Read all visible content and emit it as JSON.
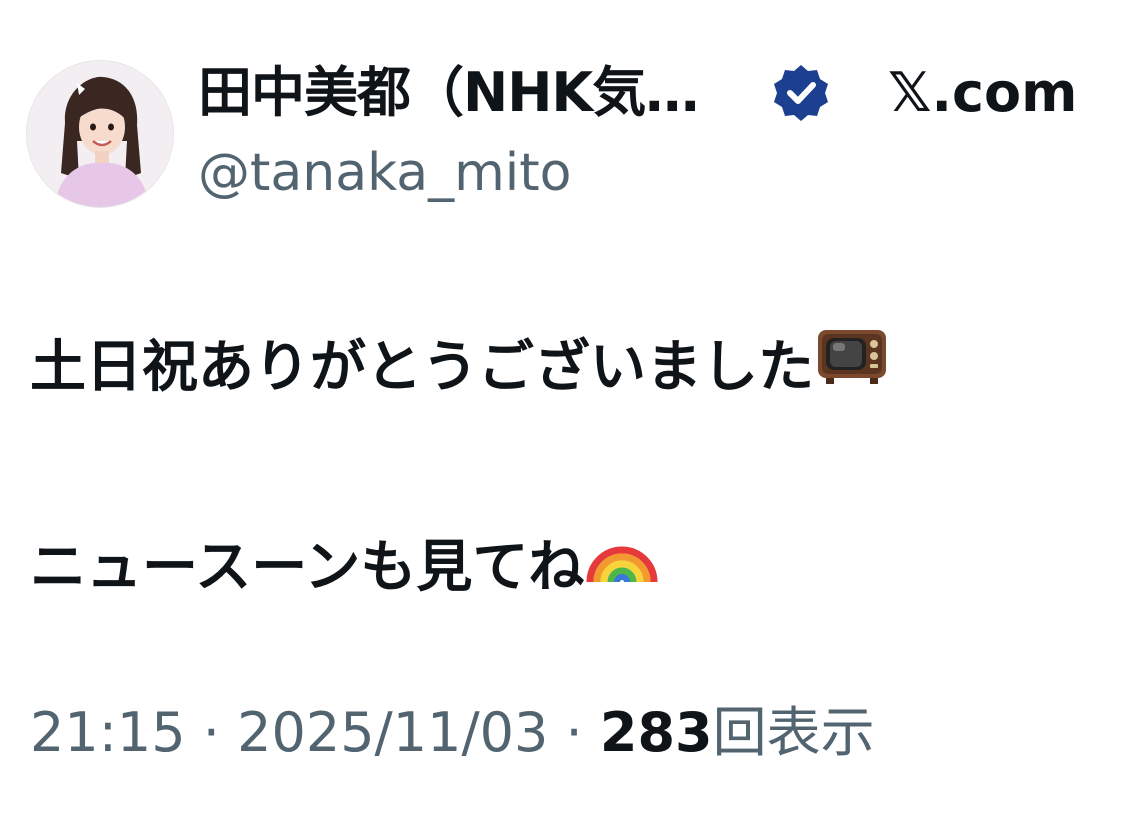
{
  "author": {
    "display_name": "田中美都（NHK気…",
    "handle": "@tanaka_mito",
    "verified": true,
    "verified_color": "#1d3f8f",
    "avatar_icon": "profile-photo"
  },
  "site": {
    "label": "𝕏.com"
  },
  "tweet": {
    "line1_text": "土日祝ありがとうございました",
    "line1_emoji": "television-emoji",
    "line2_text": "ニュースーンも見てね",
    "line2_emoji": "rainbow-emoji"
  },
  "meta": {
    "time": "21:15",
    "separator": " · ",
    "date": "2025/11/03",
    "views_count": "283",
    "views_label": "回表示"
  },
  "colors": {
    "text_primary": "#0f1419",
    "text_secondary": "#536471"
  }
}
